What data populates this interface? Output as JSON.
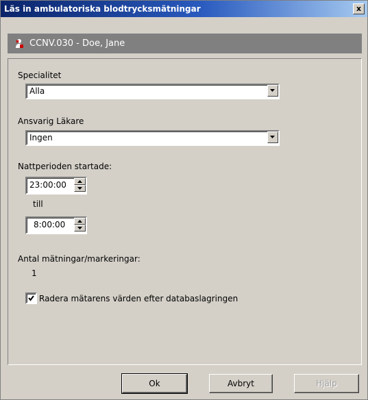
{
  "window": {
    "title": "Läs in ambulatoriska blodtrycksmätningar",
    "close_label": "x"
  },
  "patient": {
    "label": "CCNV.030 - Doe, Jane"
  },
  "specialty": {
    "label": "Specialitet",
    "value": "Alla"
  },
  "physician": {
    "label": "Ansvarig Läkare",
    "value": "Ingen"
  },
  "night": {
    "start_label": "Nattperioden startade:",
    "start_value": "23:00:00",
    "to_label": "till",
    "end_value": "8:00:00"
  },
  "count": {
    "label": "Antal mätningar/markeringar:",
    "value": "1"
  },
  "delete_option": {
    "label": "Radera mätarens värden efter databaslagringen",
    "checked": true
  },
  "buttons": {
    "ok": "Ok",
    "cancel": "Avbryt",
    "help": "Hjälp"
  }
}
